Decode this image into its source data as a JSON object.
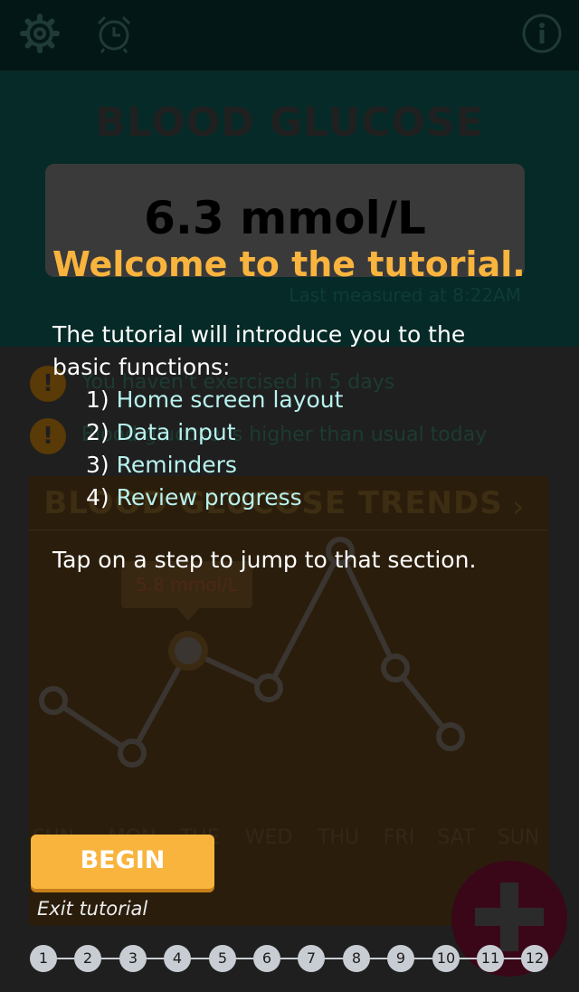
{
  "topbar": {
    "settings_icon": "gear-icon",
    "reminders_icon": "alarm-clock-icon",
    "info_icon": "info-icon"
  },
  "home": {
    "title": "BLOOD GLUCOSE",
    "reading": "6.3 mmol/L",
    "last_measured": "Last measured at 8:22AM",
    "alerts": [
      {
        "icon": "exclamation-icon",
        "text": "You haven't exercised in 5 days"
      },
      {
        "icon": "exclamation-icon",
        "text": "Blood glucose is higher than usual today"
      }
    ]
  },
  "trends": {
    "title": "BLOOD GLUCOSE TRENDS",
    "tooltip": "5.8 mmol/L",
    "days": [
      "SUN",
      "MON",
      "TUE",
      "WED",
      "THU",
      "FRI",
      "SAT",
      "SUN"
    ]
  },
  "tutorial": {
    "title": "Welcome to the tutorial.",
    "intro": "The tutorial will introduce you to the basic functions:",
    "steps": [
      {
        "num": "1)",
        "label": "Home screen layout"
      },
      {
        "num": "2)",
        "label": "Data input"
      },
      {
        "num": "3)",
        "label": "Reminders"
      },
      {
        "num": "4)",
        "label": "Review progress"
      }
    ],
    "hint": "Tap on a step to jump to that section.",
    "begin_label": "BEGIN",
    "exit_label": "Exit tutorial",
    "pager": [
      "1",
      "2",
      "3",
      "4",
      "5",
      "6",
      "7",
      "8",
      "9",
      "10",
      "11",
      "12"
    ]
  },
  "colors": {
    "accent": "#f9b43e",
    "link": "#b8f2ee",
    "hero_bg": "#062a27"
  }
}
